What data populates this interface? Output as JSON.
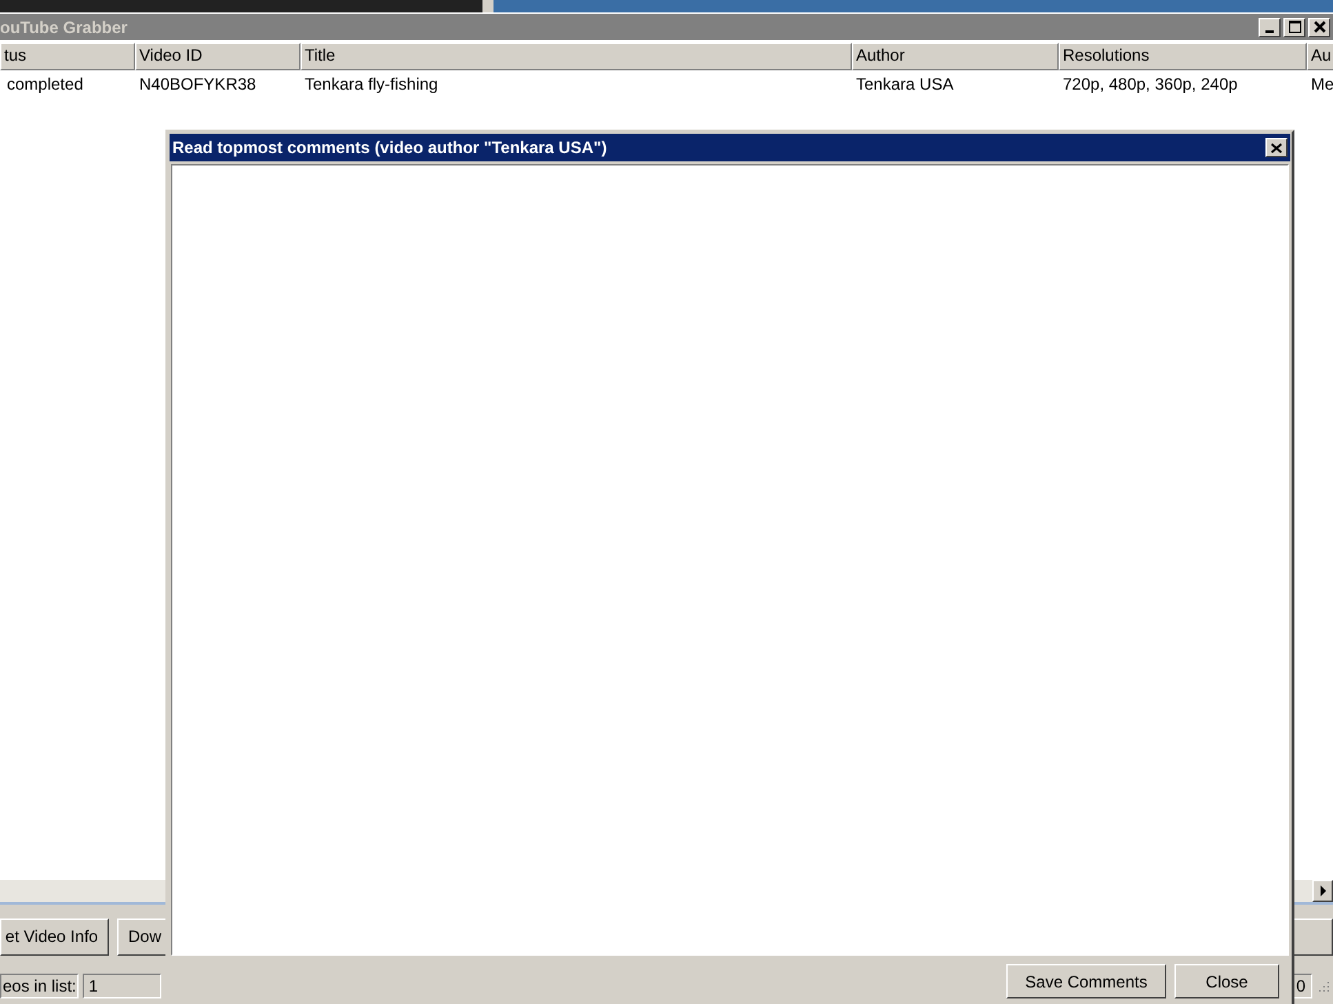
{
  "main_window": {
    "title": "ouTube Grabber",
    "columns": [
      "tus",
      "Video ID",
      "Title",
      "Author",
      "Resolutions",
      "Au"
    ],
    "rows": [
      {
        "cells": [
          "completed",
          "N40BOFYKR38",
          "Tenkara fly-fishing",
          "Tenkara USA",
          "720p, 480p, 360p, 240p",
          "Me"
        ]
      }
    ],
    "buttons": [
      "et Video Info",
      "Dow"
    ],
    "status_bar": {
      "label": "eos in list:",
      "count": "1",
      "right_value": "0"
    }
  },
  "dialog": {
    "title": "Read topmost comments (video author \"Tenkara USA\")",
    "buttons": [
      "Save Comments",
      "Close"
    ]
  }
}
